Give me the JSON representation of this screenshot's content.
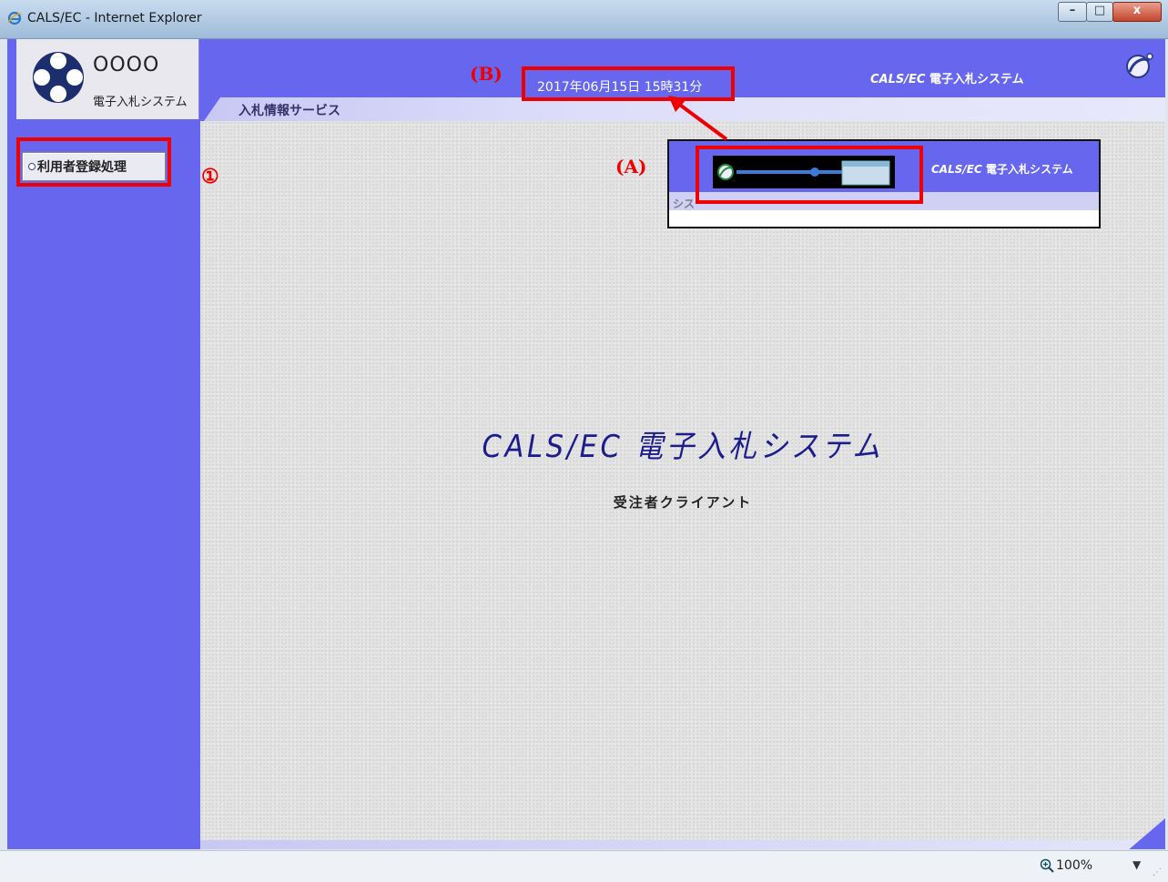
{
  "window": {
    "title": "CALS/EC - Internet Explorer",
    "min_glyph": "–",
    "max_glyph": "□",
    "close_glyph": "x"
  },
  "header": {
    "logo_text": "OOOO",
    "logo_subtext": "電子入札システム",
    "datetime": "2017年06月15日 15時31分",
    "system_name_italic": "CALS/EC",
    "system_name": "電子入札システム",
    "service_label": "入札情報サービス"
  },
  "sidebar": {
    "user_registration": "利用者登録処理"
  },
  "main": {
    "title": "CALS/EC 電子入札システム",
    "subtitle": "受注者クライアント"
  },
  "inset": {
    "system_name_italic": "CALS/EC",
    "system_name": "電子入札システム",
    "faded_menu": "シス"
  },
  "annotations": {
    "label_a": "(A)",
    "label_b": "(B)",
    "label_1": "①"
  },
  "statusbar": {
    "zoom": "100%"
  },
  "colors": {
    "accent": "#6666ee",
    "annotation_red": "#ee0000",
    "title_blue": "#1c1c8c"
  }
}
